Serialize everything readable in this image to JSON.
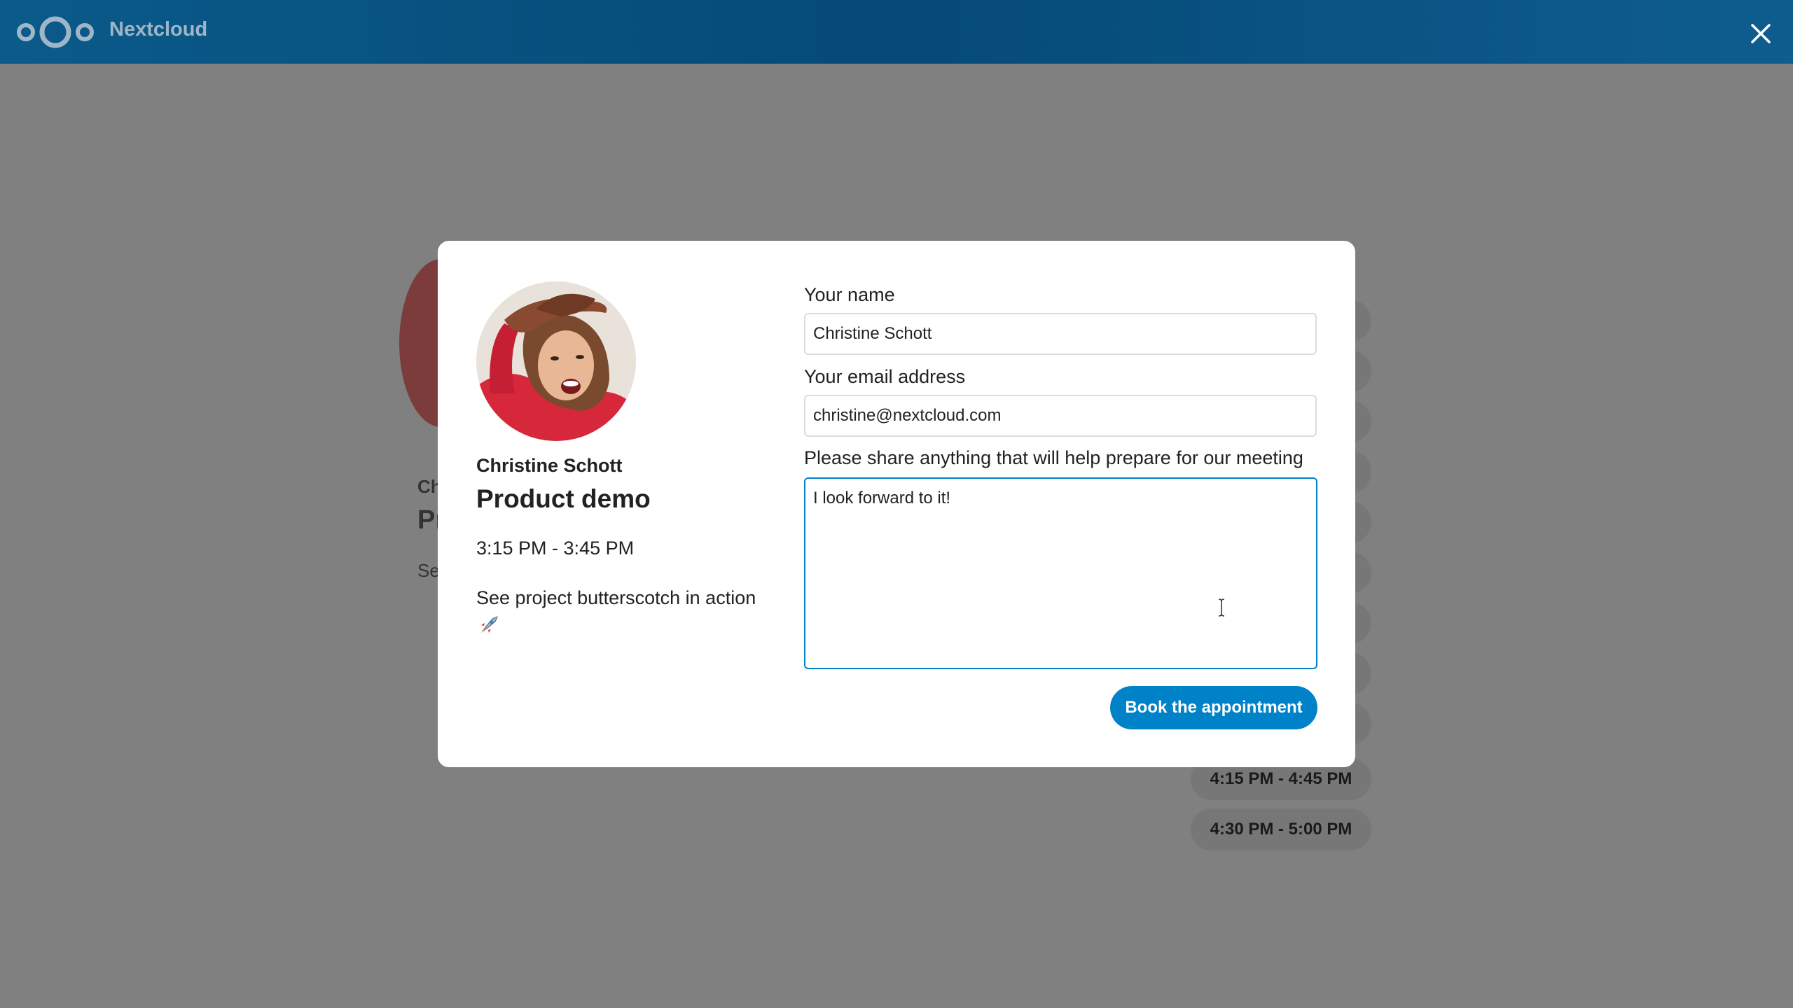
{
  "header": {
    "brand": "Nextcloud",
    "close_icon": "close-icon"
  },
  "background": {
    "name": "Ch",
    "title": "Pr",
    "desc": "Se",
    "slots": [
      "4:15 PM - 4:45 PM",
      "4:30 PM - 5:00 PM"
    ]
  },
  "modal": {
    "organizer_name": "Christine Schott",
    "title": "Product demo",
    "time": "3:15 PM - 3:45 PM",
    "description": "See project butterscotch in action",
    "name_label": "Your name",
    "name_value": "Christine Schott",
    "email_label": "Your email address",
    "email_value": "christine@nextcloud.com",
    "notes_label": "Please share anything that will help prepare for our meeting",
    "notes_value": "I look forward to it!",
    "book_label": "Book the appointment"
  },
  "colors": {
    "header": "#064a77",
    "accent": "#0082c9",
    "overlay": "#808080"
  }
}
